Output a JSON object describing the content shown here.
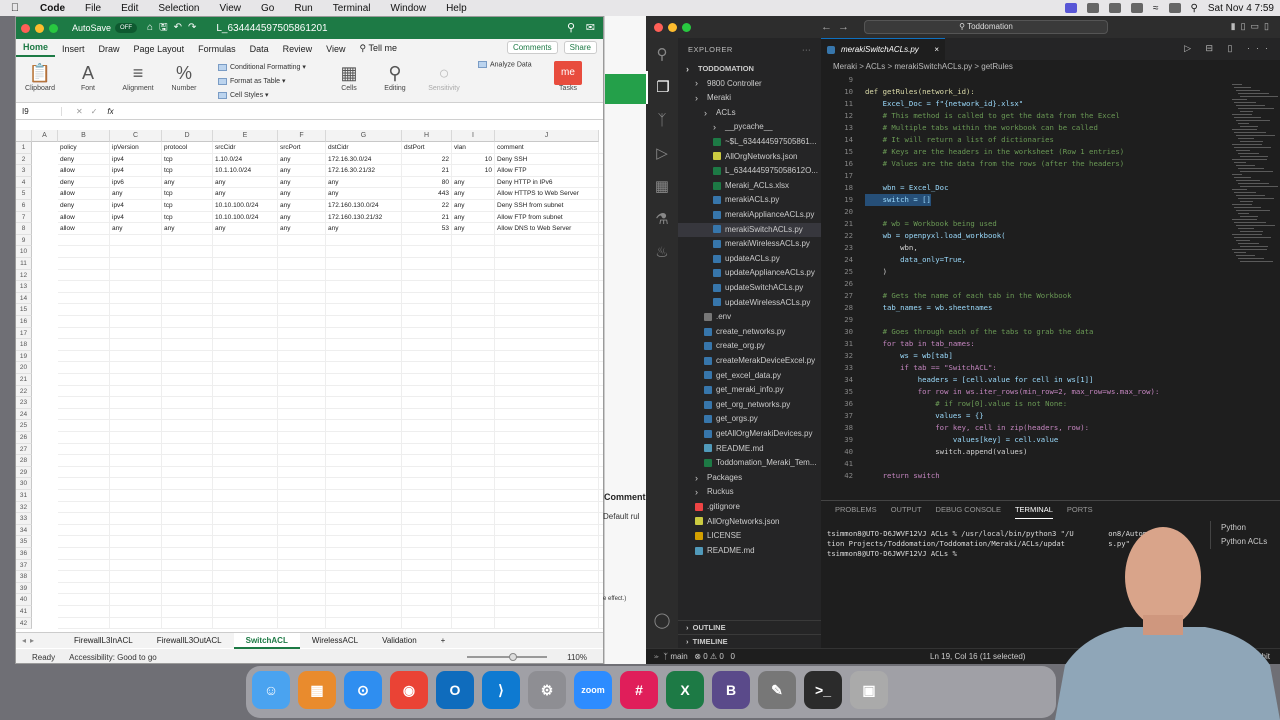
{
  "menubar": {
    "app": "Code",
    "items": [
      "File",
      "Edit",
      "Selection",
      "View",
      "Go",
      "Run",
      "Terminal",
      "Window",
      "Help"
    ],
    "datetime": "Sat Nov 4  7:59"
  },
  "excel": {
    "autosave": "AutoSave",
    "autosave_state": "OFF",
    "filename": "L_634444597505861201",
    "ribbon_tabs": [
      "Home",
      "Insert",
      "Draw",
      "Page Layout",
      "Formulas",
      "Data",
      "Review",
      "View"
    ],
    "tell_me": "Tell me",
    "comments": "Comments",
    "share": "Share",
    "groups": {
      "clipboard": "Clipboard",
      "font": "Font",
      "alignment": "Alignment",
      "number": "Number",
      "cond_fmt": "Conditional Formatting",
      "fmt_table": "Format as Table",
      "cell_styles": "Cell Styles",
      "cells": "Cells",
      "editing": "Editing",
      "sensitivity": "Sensitivity",
      "analyze": "Analyze Data",
      "tasks": "Tasks"
    },
    "name_box": "I9",
    "fx": "fx",
    "columns": [
      "A",
      "B",
      "C",
      "D",
      "E",
      "F",
      "G",
      "H",
      "I",
      "J"
    ],
    "rows": [
      [
        "policy",
        "ipVersion",
        "protocol",
        "srcCidr",
        "srcPort",
        "dstCidr",
        "dstPort",
        "vlan",
        "comment"
      ],
      [
        "deny",
        "ipv4",
        "tcp",
        "1.10.0/24",
        "any",
        "172.16.30.0/24",
        "22",
        "10",
        "Deny SSH"
      ],
      [
        "allow",
        "ipv4",
        "tcp",
        "10.1.10.0/24",
        "any",
        "172.16.30.21/32",
        "21",
        "10",
        "Allow FTP"
      ],
      [
        "deny",
        "ipv6",
        "any",
        "any",
        "any",
        "any",
        "80",
        "any",
        "Deny HTTP in IPv6"
      ],
      [
        "allow",
        "any",
        "tcp",
        "any",
        "any",
        "any",
        "443",
        "any",
        "Allow HTTPS to Web Server"
      ],
      [
        "deny",
        "ipv4",
        "tcp",
        "10.10.100.0/24",
        "any",
        "172.160.130.0/24",
        "22",
        "any",
        "Deny SSH from subnet"
      ],
      [
        "allow",
        "ipv4",
        "tcp",
        "10.10.100.0/24",
        "any",
        "172.160.130.21/32",
        "21",
        "any",
        "Allow FTP from subnet"
      ],
      [
        "allow",
        "any",
        "any",
        "any",
        "any",
        "any",
        "53",
        "any",
        "Allow DNS to Web Server"
      ]
    ],
    "sheets": [
      "FirewallL3InACL",
      "FirewallL3OutACL",
      "SwitchACL",
      "WirelessACL",
      "Validation"
    ],
    "active_sheet": "SwitchACL",
    "add_sheet": "+",
    "status_ready": "Ready",
    "status_access": "Accessibility: Good to go",
    "zoom": "110%"
  },
  "behind": {
    "comments": "Comment",
    "default_rule": "Default rul",
    "effect": "e effect.)"
  },
  "vscode": {
    "title": "Toddomation",
    "explorer": "EXPLORER",
    "tree": [
      {
        "label": "TODDOMATION",
        "depth": 0,
        "kind": "root"
      },
      {
        "label": "9800 Controller",
        "depth": 1,
        "kind": "folder"
      },
      {
        "label": "Meraki",
        "depth": 1,
        "kind": "folder"
      },
      {
        "label": "ACLs",
        "depth": 2,
        "kind": "folder"
      },
      {
        "label": "__pycache__",
        "depth": 3,
        "kind": "folder"
      },
      {
        "label": "~$L_634444597505861...",
        "depth": 3,
        "kind": "xlsx"
      },
      {
        "label": "AllOrgNetworks.json",
        "depth": 3,
        "kind": "json"
      },
      {
        "label": "L_6344445975058612O...",
        "depth": 3,
        "kind": "xlsx"
      },
      {
        "label": "Meraki_ACLs.xlsx",
        "depth": 3,
        "kind": "xlsx"
      },
      {
        "label": "merakiACLs.py",
        "depth": 3,
        "kind": "py"
      },
      {
        "label": "merakiApplianceACLs.py",
        "depth": 3,
        "kind": "py"
      },
      {
        "label": "merakiSwitchACLs.py",
        "depth": 3,
        "kind": "py",
        "selected": true
      },
      {
        "label": "merakiWirelessACLs.py",
        "depth": 3,
        "kind": "py"
      },
      {
        "label": "updateACLs.py",
        "depth": 3,
        "kind": "py"
      },
      {
        "label": "updateApplianceACLs.py",
        "depth": 3,
        "kind": "py"
      },
      {
        "label": "updateSwitchACLs.py",
        "depth": 3,
        "kind": "py"
      },
      {
        "label": "updateWirelessACLs.py",
        "depth": 3,
        "kind": "py"
      },
      {
        "label": ".env",
        "depth": 2,
        "kind": "env"
      },
      {
        "label": "create_networks.py",
        "depth": 2,
        "kind": "py"
      },
      {
        "label": "create_org.py",
        "depth": 2,
        "kind": "py"
      },
      {
        "label": "createMerakDeviceExcel.py",
        "depth": 2,
        "kind": "py"
      },
      {
        "label": "get_excel_data.py",
        "depth": 2,
        "kind": "py"
      },
      {
        "label": "get_meraki_info.py",
        "depth": 2,
        "kind": "py"
      },
      {
        "label": "get_org_networks.py",
        "depth": 2,
        "kind": "py"
      },
      {
        "label": "get_orgs.py",
        "depth": 2,
        "kind": "py"
      },
      {
        "label": "getAllOrgMerakiDevices.py",
        "depth": 2,
        "kind": "py"
      },
      {
        "label": "README.md",
        "depth": 2,
        "kind": "md"
      },
      {
        "label": "Toddomation_Meraki_Tem...",
        "depth": 2,
        "kind": "xlsx"
      },
      {
        "label": "Packages",
        "depth": 1,
        "kind": "folder"
      },
      {
        "label": "Ruckus",
        "depth": 1,
        "kind": "folder"
      },
      {
        "label": ".gitignore",
        "depth": 1,
        "kind": "git"
      },
      {
        "label": "AllOrgNetworks.json",
        "depth": 1,
        "kind": "json"
      },
      {
        "label": "LICENSE",
        "depth": 1,
        "kind": "lic"
      },
      {
        "label": "README.md",
        "depth": 1,
        "kind": "md"
      }
    ],
    "outline": "OUTLINE",
    "timeline": "TIMELINE",
    "tab": "merakiSwitchACLs.py",
    "tab_close": "×",
    "breadcrumb": "Meraki  >  ACLs  >  merakiSwitchACLs.py  >  getRules",
    "code": [
      {
        "n": "9",
        "t": ""
      },
      {
        "n": "10",
        "t": "def getRules(network_id):"
      },
      {
        "n": "11",
        "t": "    Excel_Doc = f\"{network_id}.xlsx\""
      },
      {
        "n": "12",
        "t": "    # This method is called to get the data from the Excel"
      },
      {
        "n": "13",
        "t": "    # Multiple tabs within the workbook can be called"
      },
      {
        "n": "14",
        "t": "    # It will return a list of dictionaries"
      },
      {
        "n": "15",
        "t": "    # Keys are the headers in the worksheet (Row 1 entries)"
      },
      {
        "n": "16",
        "t": "    # Values are the data from the rows (after the headers)"
      },
      {
        "n": "17",
        "t": ""
      },
      {
        "n": "18",
        "t": "    wbn = Excel_Doc"
      },
      {
        "n": "19",
        "t": "    switch = []"
      },
      {
        "n": "20",
        "t": ""
      },
      {
        "n": "21",
        "t": "    # wb = Workbook being used"
      },
      {
        "n": "22",
        "t": "    wb = openpyxl.load_workbook("
      },
      {
        "n": "23",
        "t": "        wbn,"
      },
      {
        "n": "24",
        "t": "        data_only=True,"
      },
      {
        "n": "25",
        "t": "    )"
      },
      {
        "n": "26",
        "t": ""
      },
      {
        "n": "27",
        "t": "    # Gets the name of each tab in the Workbook"
      },
      {
        "n": "28",
        "t": "    tab_names = wb.sheetnames"
      },
      {
        "n": "29",
        "t": ""
      },
      {
        "n": "30",
        "t": "    # Goes through each of the tabs to grab the data"
      },
      {
        "n": "31",
        "t": "    for tab in tab_names:"
      },
      {
        "n": "32",
        "t": "        ws = wb[tab]"
      },
      {
        "n": "33",
        "t": "        if tab == \"SwitchACL\":"
      },
      {
        "n": "34",
        "t": "            headers = [cell.value for cell in ws[1]]"
      },
      {
        "n": "35",
        "t": "            for row in ws.iter_rows(min_row=2, max_row=ws.max_row):"
      },
      {
        "n": "36",
        "t": "                # if row[0].value is not None:"
      },
      {
        "n": "37",
        "t": "                values = {}"
      },
      {
        "n": "38",
        "t": "                for key, cell in zip(headers, row):"
      },
      {
        "n": "39",
        "t": "                    values[key] = cell.value"
      },
      {
        "n": "40",
        "t": "                switch.append(values)"
      },
      {
        "n": "41",
        "t": ""
      },
      {
        "n": "42",
        "t": "    return switch"
      }
    ],
    "panel_tabs": [
      "PROBLEMS",
      "OUTPUT",
      "DEBUG CONSOLE",
      "TERMINAL",
      "PORTS"
    ],
    "active_panel": "TERMINAL",
    "terminal": [
      "tsimmon8@UTO-D6JWVF12VJ ACLs % /usr/local/bin/python3 \"/U        on8/Automa",
      "tion Projects/Toddomation/Toddomation/Meraki/ACLs/updat          s.py\"",
      "tsimmon8@UTO-D6JWVF12VJ ACLs % "
    ],
    "terminals": [
      "Python",
      "Python  ACLs"
    ],
    "status_branch": "main",
    "status_problems": "⊗ 0  ⚠ 0",
    "status_ports": "0",
    "status_pos": "Ln 19, Col 16 (11 selected)",
    "status_right": ".1 64-bit"
  },
  "dock": [
    "Finder",
    "Launchpad",
    "Safari",
    "Chrome",
    "Outlook",
    "VS Code",
    "Settings",
    "Zoom",
    "Slack",
    "Excel",
    "BBEdit",
    "Script",
    "Terminal",
    "Preview"
  ]
}
